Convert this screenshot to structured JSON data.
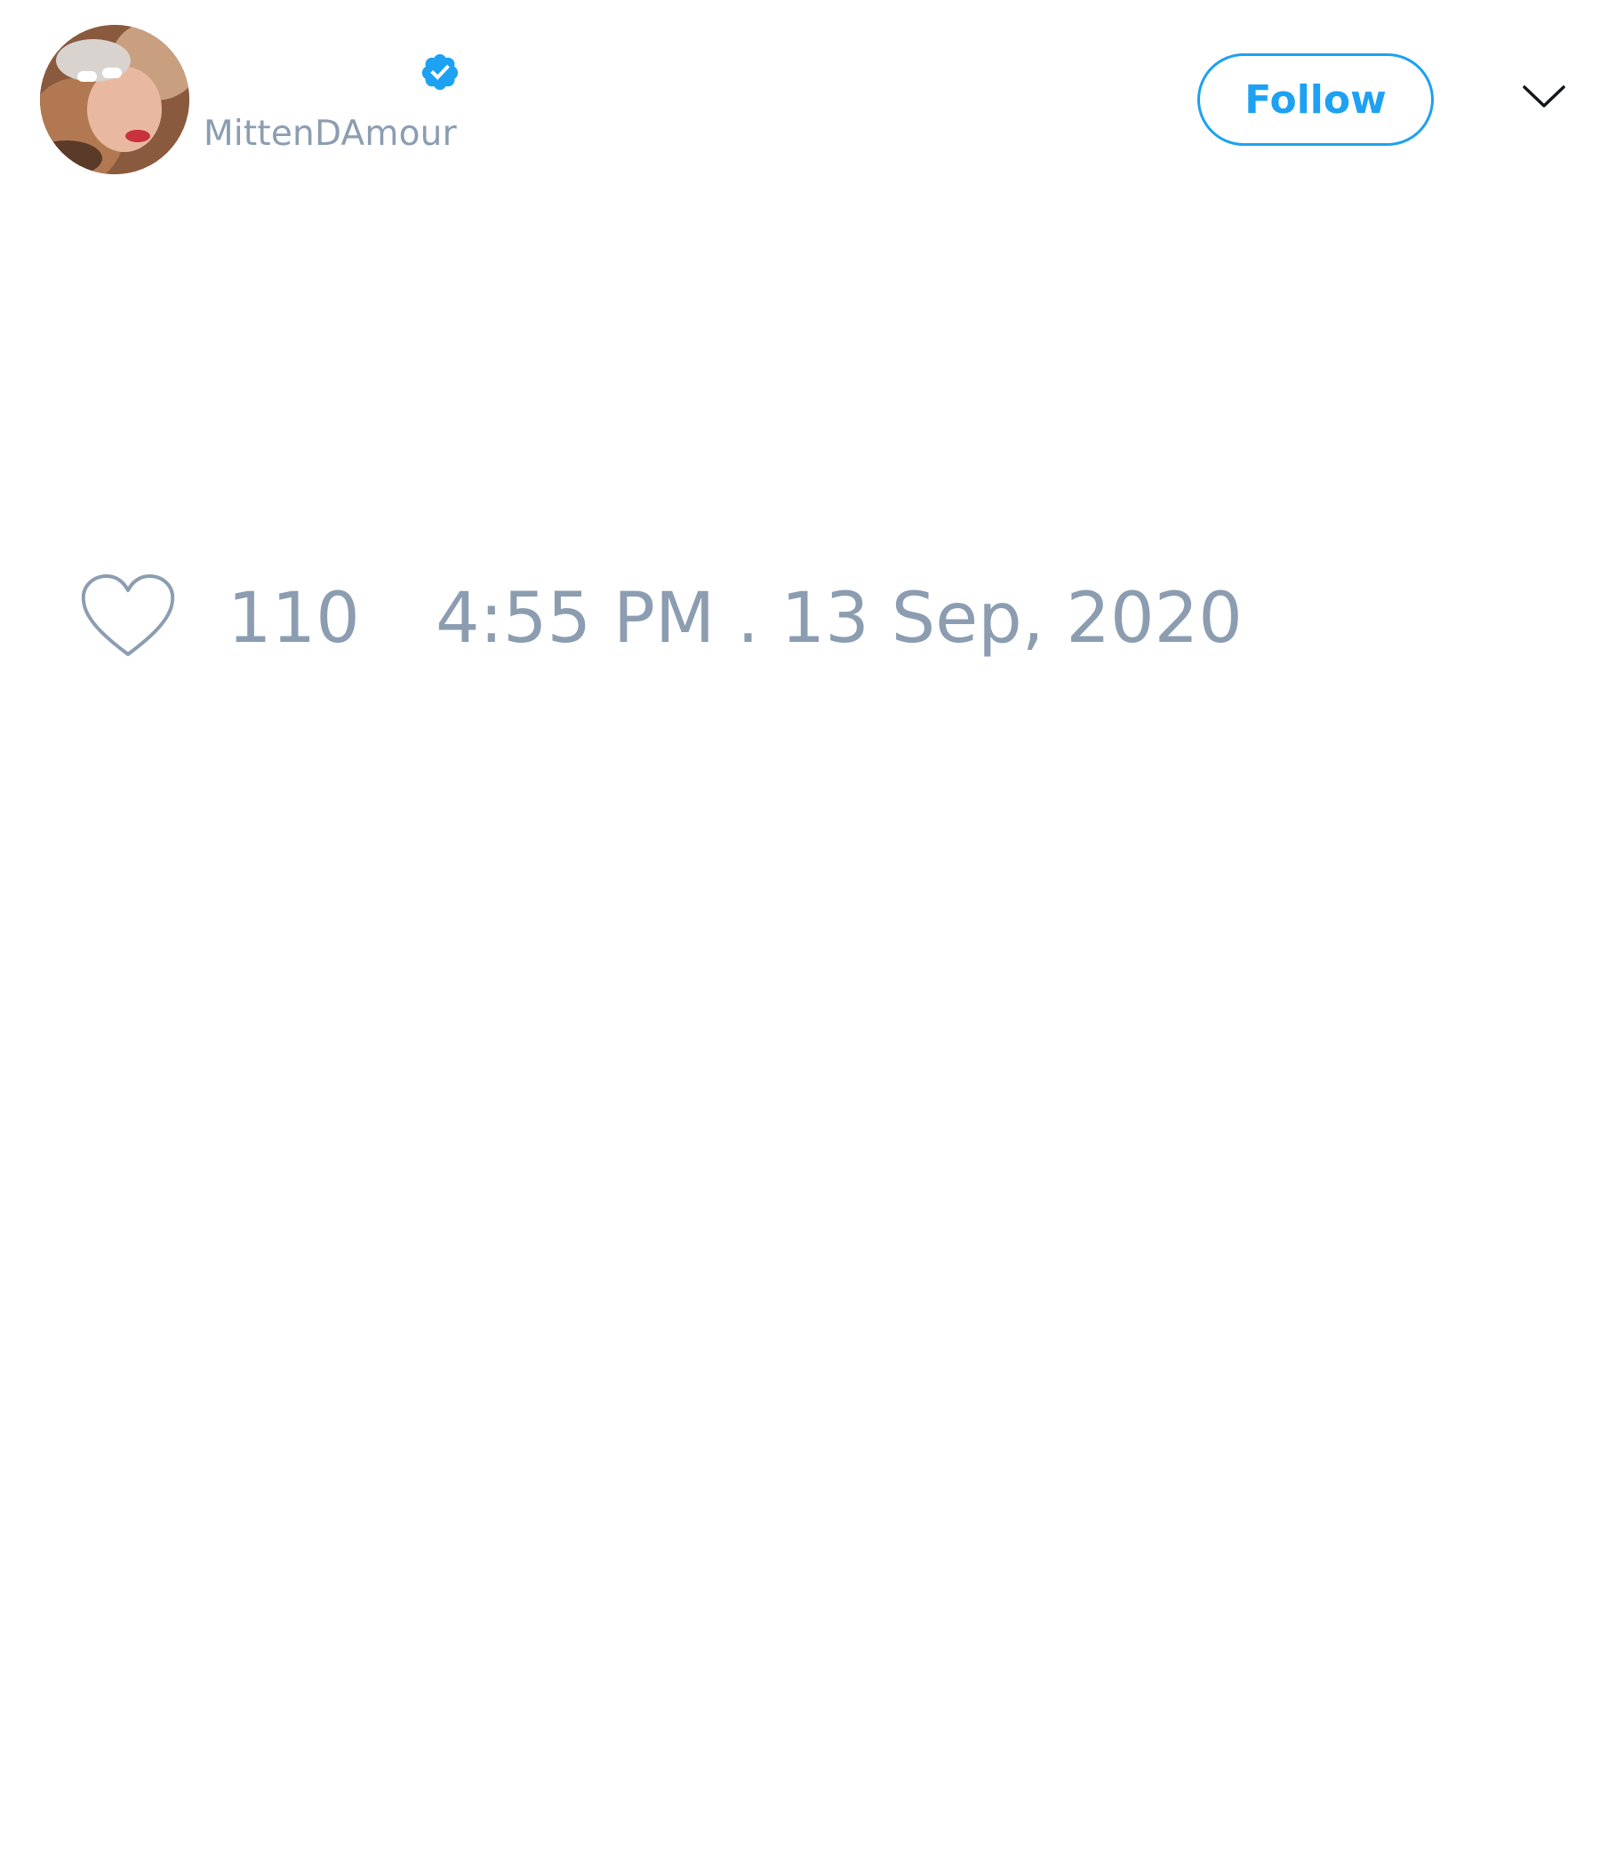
{
  "tweet": {
    "author": {
      "display_name": "",
      "username": "MittenDAmour",
      "verified": true
    },
    "follow_label": "Follow",
    "likes": "110",
    "timestamp": "4:55 PM . 13 Sep, 2020"
  },
  "icons": {
    "verified": "verified-badge-icon",
    "menu": "chevron-down-icon",
    "like": "heart-icon"
  },
  "colors": {
    "accent": "#1da1f2",
    "muted_text": "#8c9db1",
    "background": "#ffffff"
  }
}
